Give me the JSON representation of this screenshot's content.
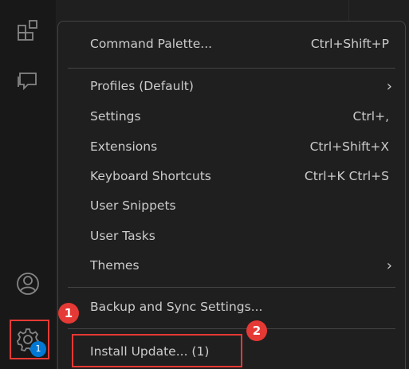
{
  "activity_bar": {
    "icons": [
      "extensions-icon",
      "remote-explorer-icon",
      "accounts-icon",
      "manage-gear-icon"
    ],
    "badge": "1"
  },
  "annotations": {
    "marker1": "1",
    "marker2": "2",
    "color": "#e53935"
  },
  "menu": {
    "command_palette": {
      "label": "Command Palette...",
      "shortcut": "Ctrl+Shift+P"
    },
    "profiles": {
      "label": "Profiles (Default)",
      "submenu": "›"
    },
    "settings": {
      "label": "Settings",
      "shortcut": "Ctrl+,"
    },
    "extensions": {
      "label": "Extensions",
      "shortcut": "Ctrl+Shift+X"
    },
    "keyboard_shortcuts": {
      "label": "Keyboard Shortcuts",
      "shortcut": "Ctrl+K Ctrl+S"
    },
    "user_snippets": {
      "label": "User Snippets"
    },
    "user_tasks": {
      "label": "User Tasks"
    },
    "themes": {
      "label": "Themes",
      "submenu": "›"
    },
    "backup_sync": {
      "label": "Backup and Sync Settings..."
    },
    "install_update": {
      "label": "Install Update... (1)"
    }
  },
  "colors": {
    "accent_badge": "#0078d4",
    "menu_bg": "#1f1f1f",
    "menu_border": "#454545",
    "text": "#cccccc"
  }
}
